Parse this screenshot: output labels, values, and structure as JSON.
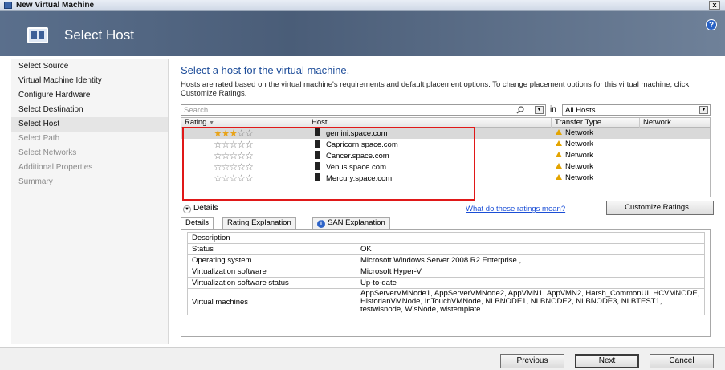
{
  "window": {
    "title": "New Virtual Machine",
    "close_glyph": "x"
  },
  "header": {
    "title": "Select Host",
    "help_glyph": "?"
  },
  "nav": {
    "items": [
      {
        "label": "Select Source",
        "state": "normal"
      },
      {
        "label": "Virtual Machine Identity",
        "state": "normal"
      },
      {
        "label": "Configure Hardware",
        "state": "normal"
      },
      {
        "label": "Select Destination",
        "state": "normal"
      },
      {
        "label": "Select Host",
        "state": "active"
      },
      {
        "label": "Select Path",
        "state": "disabled"
      },
      {
        "label": "Select Networks",
        "state": "disabled"
      },
      {
        "label": "Additional Properties",
        "state": "disabled"
      },
      {
        "label": "Summary",
        "state": "disabled"
      }
    ]
  },
  "main": {
    "heading": "Select a host for the virtual machine.",
    "description": "Hosts are rated based on the virtual machine's requirements and default placement options. To change placement options for this virtual machine, click Customize Ratings.",
    "search": {
      "placeholder": "Search",
      "in_label": "in",
      "scope_value": "All Hosts"
    },
    "grid": {
      "columns": [
        "Rating",
        "Host",
        "Transfer Type",
        "Network ..."
      ],
      "rows": [
        {
          "rating": 3,
          "host": "gemini.space.com",
          "transfer": "Network",
          "selected": true
        },
        {
          "rating": 0,
          "host": "Capricorn.space.com",
          "transfer": "Network",
          "selected": false
        },
        {
          "rating": 0,
          "host": "Cancer.space.com",
          "transfer": "Network",
          "selected": false
        },
        {
          "rating": 0,
          "host": "Venus.space.com",
          "transfer": "Network",
          "selected": false
        },
        {
          "rating": 0,
          "host": "Mercury.space.com",
          "transfer": "Network",
          "selected": false
        }
      ],
      "max_rating": 5
    },
    "details": {
      "toggle_label": "Details",
      "ratings_link": "What do these ratings mean?",
      "customize_button": "Customize Ratings...",
      "tabs": [
        "Details",
        "Rating Explanation",
        "SAN Explanation"
      ],
      "table": {
        "section": "Description",
        "rows": [
          {
            "key": "Status",
            "value": "OK"
          },
          {
            "key": "Operating system",
            "value": "Microsoft Windows Server 2008 R2 Enterprise ,"
          },
          {
            "key": "Virtualization software",
            "value": "Microsoft Hyper-V"
          },
          {
            "key": "Virtualization software status",
            "value": "Up-to-date"
          },
          {
            "key": "Virtual machines",
            "value": "AppServerVMNode1, AppServerVMNode2, AppVMN1, AppVMN2, Harsh_CommonUI, HCVMNODE, HistorianVMNode, InTouchVMNode, NLBNODE1, NLBNODE2, NLBNODE3, NLBTEST1, testwisnode, WisNode, wistemplate"
          }
        ]
      }
    }
  },
  "footer": {
    "previous": "Previous",
    "next": "Next",
    "cancel": "Cancel"
  },
  "colors": {
    "heading": "#1f4e9a",
    "star_filled": "#e8a319",
    "star_empty": "#7c7c7c",
    "highlight": "#e01818",
    "link": "#1a4ed6"
  }
}
